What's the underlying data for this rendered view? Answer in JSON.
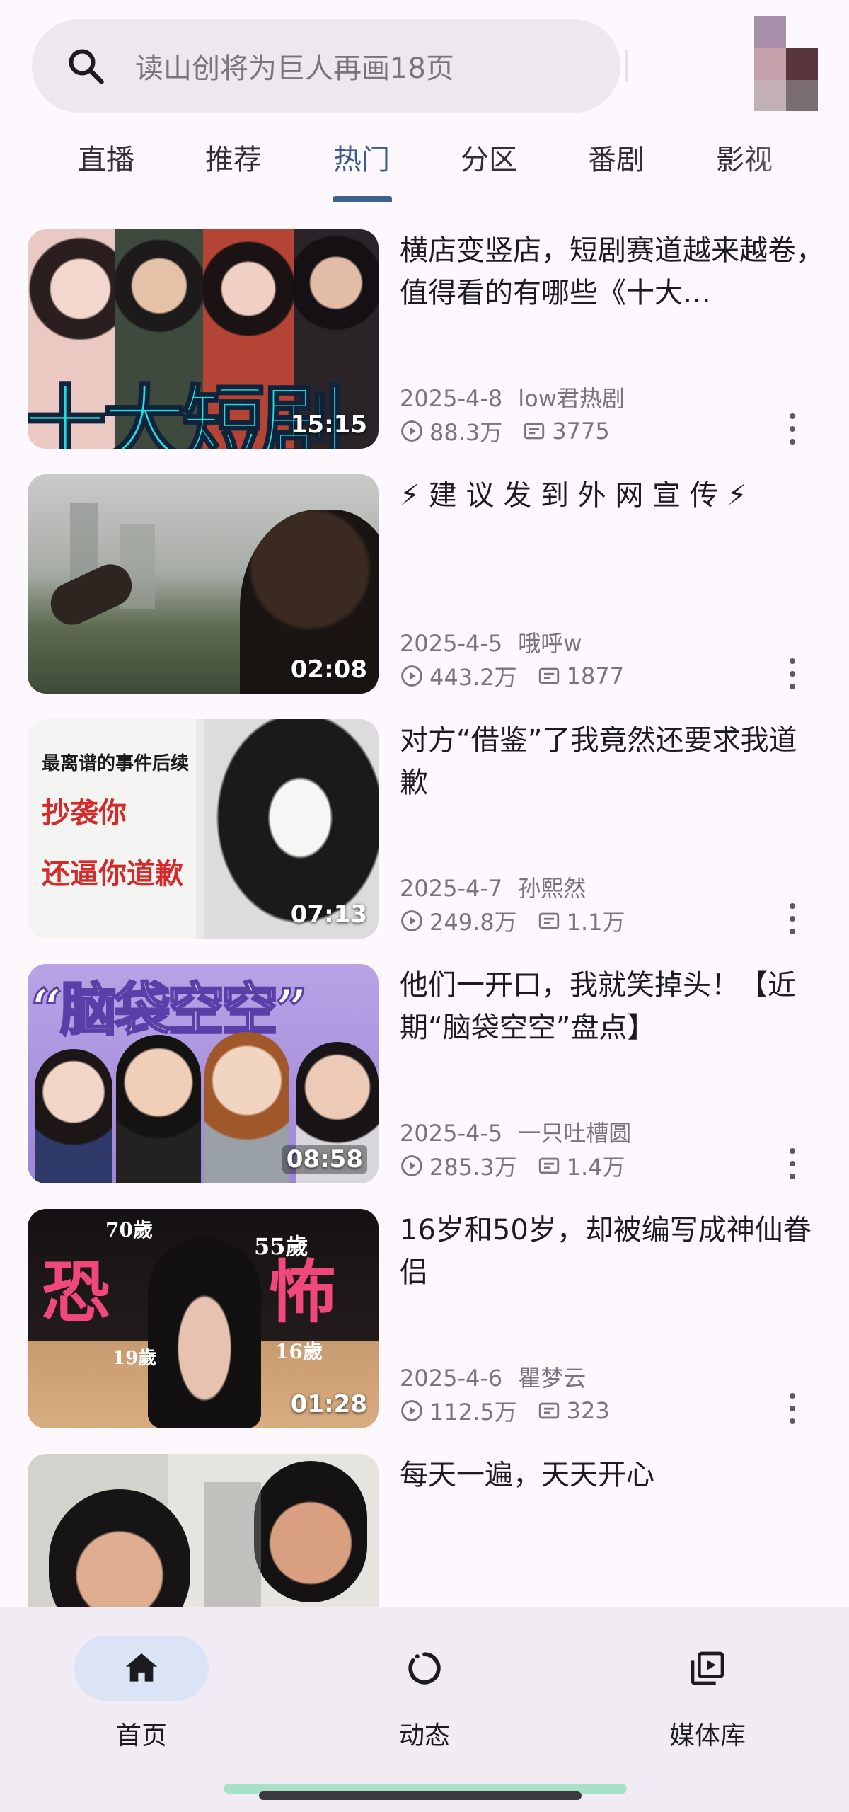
{
  "search": {
    "placeholder": "读山创将为巨人再画18页"
  },
  "tabs": [
    {
      "label": "直播",
      "active": false
    },
    {
      "label": "推荐",
      "active": false
    },
    {
      "label": "热门",
      "active": true
    },
    {
      "label": "分区",
      "active": false
    },
    {
      "label": "番剧",
      "active": false
    },
    {
      "label": "影视",
      "active": false
    }
  ],
  "videos": [
    {
      "title": "横店变竖店，短剧赛道越来越卷，值得看的有哪些《十大…",
      "date": "2025-4-8",
      "author": "low君热剧",
      "views": "88.3万",
      "danmaku": "3775",
      "duration": "15:15",
      "thumb_text": "十大短剧"
    },
    {
      "title": "⚡ 建 议 发 到 外 网 宣 传 ⚡",
      "date": "2025-4-5",
      "author": "哦呼w",
      "views": "443.2万",
      "danmaku": "1877",
      "duration": "02:08",
      "thumb_text": ""
    },
    {
      "title": "对方“借鉴”了我竟然还要求我道歉",
      "date": "2025-4-7",
      "author": "孙熙然",
      "views": "249.8万",
      "danmaku": "1.1万",
      "duration": "07:13",
      "thumb_text": "最离谱的事件后续",
      "thumb_text2": "抄袭你",
      "thumb_text3": "还逼你道歉"
    },
    {
      "title": "他们一开口，我就笑掉头！【近期“脑袋空空”盘点】",
      "date": "2025-4-5",
      "author": "一只吐槽圆",
      "views": "285.3万",
      "danmaku": "1.4万",
      "duration": "08:58",
      "thumb_text": "“脑袋空空”"
    },
    {
      "title": "16岁和50岁，却被编写成神仙眷侣",
      "date": "2025-4-6",
      "author": "瞿梦云",
      "views": "112.5万",
      "danmaku": "323",
      "duration": "01:28",
      "thumb_text": "恐",
      "thumb_text2": "怖",
      "thumb_text3": "70歲",
      "thumb_text4": "55歲",
      "thumb_text5": "19歲",
      "thumb_text6": "16歲"
    },
    {
      "title": "每天一遍，天天开心",
      "date": "",
      "author": "",
      "views": "",
      "danmaku": "",
      "duration": "",
      "thumb_text": ""
    }
  ],
  "bottom_nav": [
    {
      "label": "首页",
      "icon": "home-icon",
      "active": true
    },
    {
      "label": "动态",
      "icon": "activity-icon",
      "active": false
    },
    {
      "label": "媒体库",
      "icon": "library-icon",
      "active": false
    }
  ],
  "colors": {
    "background": "#fdf8fd",
    "accent": "#3f5f8f",
    "nav_active_pill": "#dbe3f7"
  }
}
